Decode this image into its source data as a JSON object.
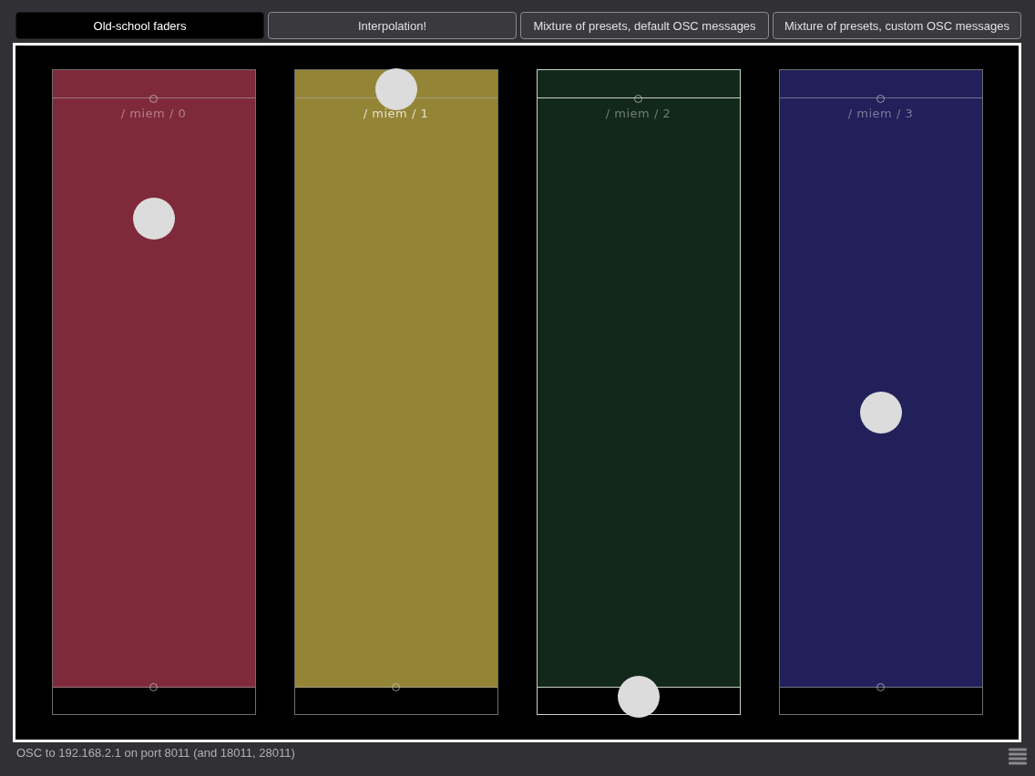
{
  "tabs": [
    {
      "label": "Old-school faders",
      "selected": true
    },
    {
      "label": "Interpolation!",
      "selected": false
    },
    {
      "label": "Mixture of presets, default OSC messages",
      "selected": false
    },
    {
      "label": "Mixture of presets, custom OSC messages",
      "selected": false
    }
  ],
  "faders": [
    {
      "label": "/ miem / 0",
      "color": "#7f2a3b",
      "level": 0.77,
      "highlighted": false
    },
    {
      "label": "/ miem / 1",
      "color": "#948536",
      "level": 0.97,
      "highlighted": false
    },
    {
      "label": "/ miem / 2",
      "color": "#12281a",
      "level": 0.03,
      "highlighted": true
    },
    {
      "label": "/ miem / 3",
      "color": "#22205a",
      "level": 0.47,
      "highlighted": false
    }
  ],
  "status_bar": {
    "text": "OSC to 192.168.2.1 on port 8011 (and 18011, 28011)"
  }
}
